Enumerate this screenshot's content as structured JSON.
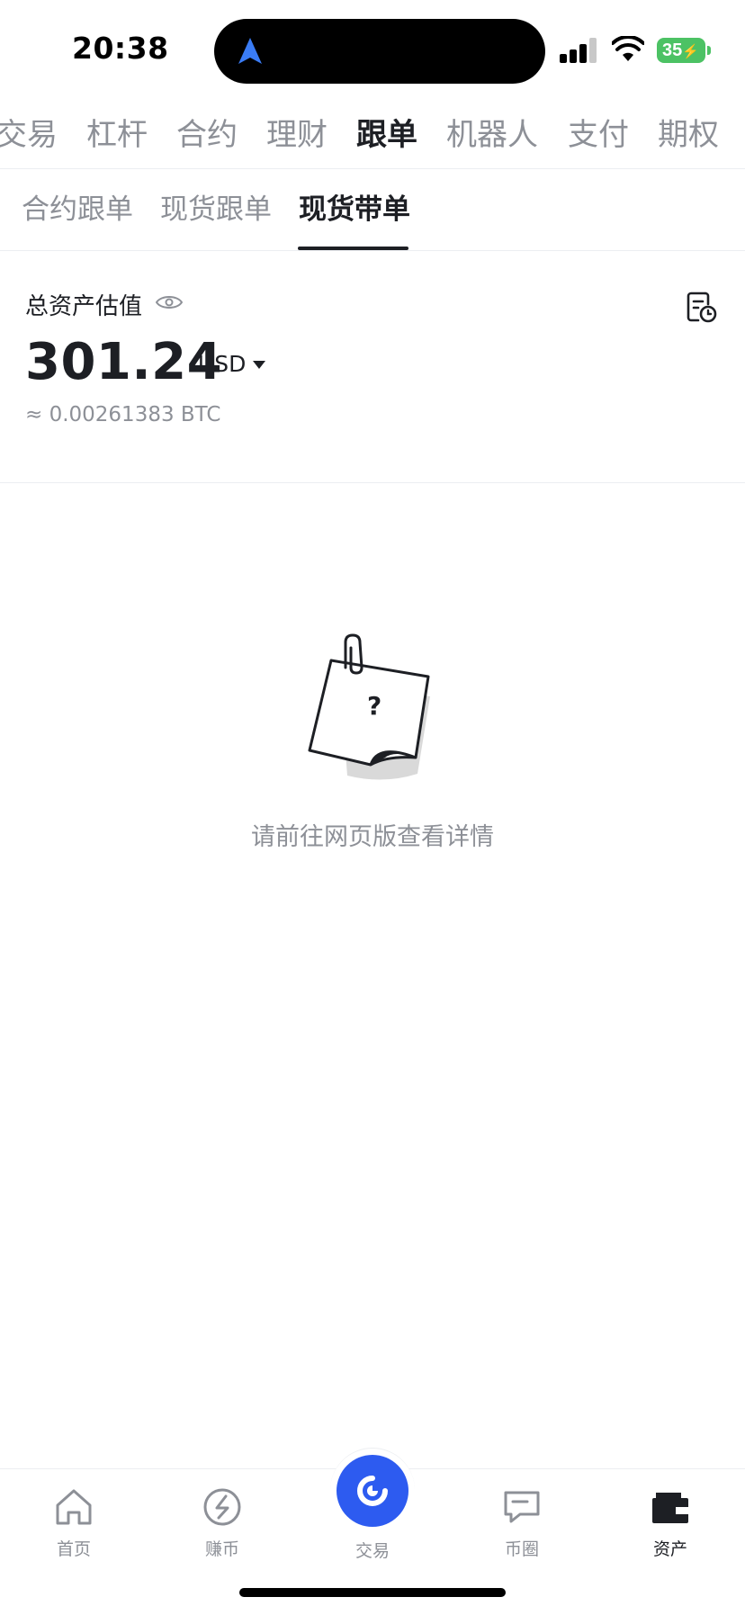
{
  "status_bar": {
    "time": "20:38",
    "battery": "35"
  },
  "top_tabs": [
    {
      "label": "交易"
    },
    {
      "label": "杠杆"
    },
    {
      "label": "合约"
    },
    {
      "label": "理财"
    },
    {
      "label": "跟单",
      "active": true
    },
    {
      "label": "机器人"
    },
    {
      "label": "支付"
    },
    {
      "label": "期权"
    }
  ],
  "sub_tabs": [
    {
      "label": "合约跟单"
    },
    {
      "label": "现货跟单"
    },
    {
      "label": "现货带单",
      "active": true
    }
  ],
  "summary": {
    "label": "总资产估值",
    "value": "301.24",
    "currency": "USD",
    "btc_equivalent": "≈ 0.00261383 BTC"
  },
  "empty_state": {
    "message": "请前往网页版查看详情"
  },
  "bottom_nav": [
    {
      "label": "首页",
      "icon": "home-icon"
    },
    {
      "label": "赚币",
      "icon": "earn-icon"
    },
    {
      "label": "交易",
      "icon": "trade-icon"
    },
    {
      "label": "币圈",
      "icon": "community-icon"
    },
    {
      "label": "资产",
      "icon": "wallet-icon",
      "active": true
    }
  ],
  "colors": {
    "accent": "#2d5bf0",
    "battery": "#4cc264",
    "muted": "#8d9097",
    "text": "#1d1f24"
  }
}
